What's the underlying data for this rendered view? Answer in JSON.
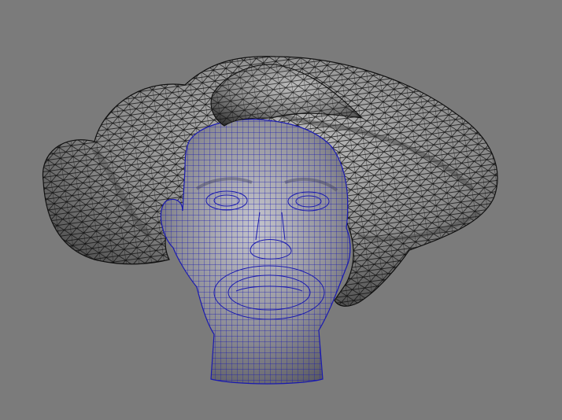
{
  "viewport": {
    "background_color": "#7b7b7b",
    "display_mode": "wireframe-on-shaded"
  },
  "hair": {
    "object": "hair-mesh",
    "wire_color": "#101010",
    "shade_color": "#8c8c8c",
    "highlight_color": "#bdbdbd",
    "topology": "triangles"
  },
  "head": {
    "object": "head-mesh",
    "wire_color": "#1a1ab0",
    "shade_color": "#8e8e96",
    "highlight_color": "#c4c4cc",
    "topology": "quads",
    "selected": true
  }
}
